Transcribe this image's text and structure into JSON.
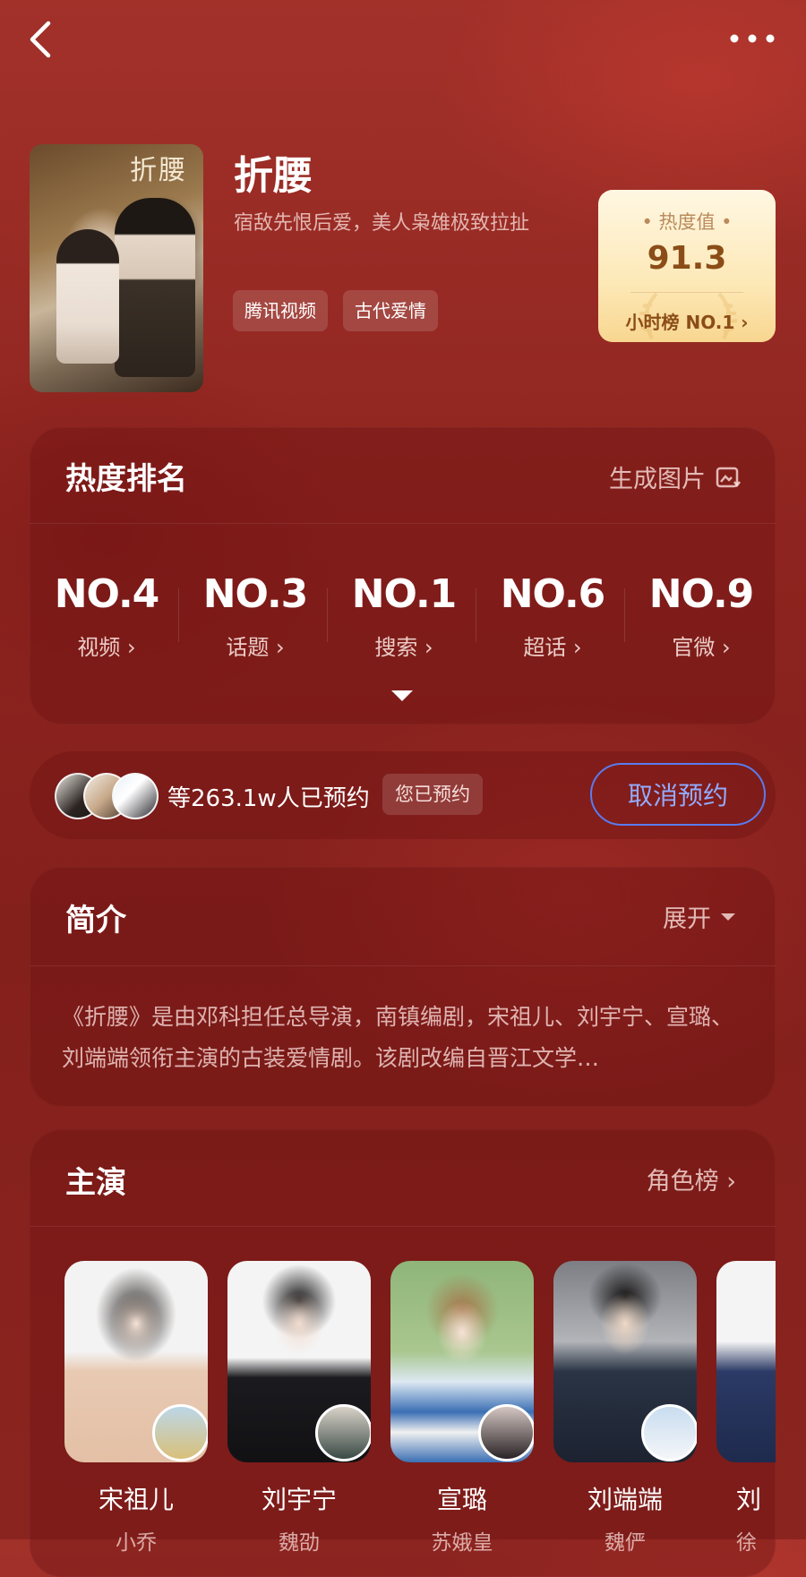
{
  "nav": {
    "back_icon": "chevron-left-icon",
    "more_icon": "more-dots-icon"
  },
  "show": {
    "title": "折腰",
    "description": "宿敌先恨后爱，美人枭雄极致拉扯",
    "tags": [
      "腾讯视频",
      "古代爱情"
    ],
    "poster_text": "折腰"
  },
  "heat": {
    "label": "• 热度值 •",
    "value": "91.3",
    "rank_label": "小时榜  NO.1 ›"
  },
  "ranking": {
    "title": "热度排名",
    "action": "生成图片",
    "items": [
      {
        "rank": "NO.4",
        "label": "视频 ›"
      },
      {
        "rank": "NO.3",
        "label": "话题 ›"
      },
      {
        "rank": "NO.1",
        "label": "搜索 ›"
      },
      {
        "rank": "NO.6",
        "label": "超话 ›"
      },
      {
        "rank": "NO.9",
        "label": "官微 ›"
      }
    ]
  },
  "reservation": {
    "count_text": "等263.1w人已预约",
    "status_badge": "您已预约",
    "cancel_label": "取消预约"
  },
  "intro": {
    "title": "简介",
    "expand_label": "展开",
    "text": "《折腰》是由邓科担任总导演，南镇编剧，宋祖儿、刘宇宁、宣璐、刘端端领衔主演的古装爱情剧。该剧改编自晋江文学…"
  },
  "cast": {
    "title": "主演",
    "action": "角色榜 ›",
    "members": [
      {
        "name": "宋祖儿",
        "role": "小乔"
      },
      {
        "name": "刘宇宁",
        "role": "魏劭"
      },
      {
        "name": "宣璐",
        "role": "苏娥皇"
      },
      {
        "name": "刘端端",
        "role": "魏俨"
      },
      {
        "name": "刘",
        "role": "徐"
      }
    ]
  },
  "colors": {
    "accent_blue": "#5a7cf0",
    "heat_gold": "#8b4d17",
    "background": "#8e241f"
  }
}
